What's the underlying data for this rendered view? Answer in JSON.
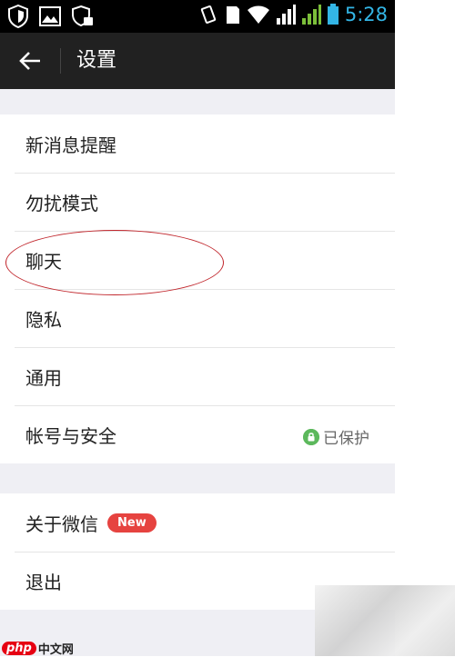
{
  "status_bar": {
    "time": "5:28",
    "icons": [
      "shield-icon",
      "image-icon",
      "security-icon",
      "vibrate-icon",
      "sdcard-icon",
      "wifi-icon",
      "signal-icon",
      "signal-icon",
      "battery-icon"
    ]
  },
  "app_bar": {
    "title": "设置",
    "back_icon": "back-arrow-icon"
  },
  "settings": {
    "group1": [
      {
        "label": "新消息提醒"
      },
      {
        "label": "勿扰模式"
      },
      {
        "label": "聊天"
      },
      {
        "label": "隐私"
      },
      {
        "label": "通用"
      },
      {
        "label": "帐号与安全",
        "status": "已保护"
      }
    ],
    "group2": [
      {
        "label": "关于微信",
        "badge": "New"
      },
      {
        "label": "退出"
      }
    ]
  },
  "watermark": {
    "logo": "php",
    "text": "中文网"
  },
  "colors": {
    "app_bar": "#212121",
    "status_bar": "#000000",
    "background": "#efeff4",
    "badge": "#e64340",
    "lock": "#5cb85c",
    "time": "#33b5e5"
  }
}
